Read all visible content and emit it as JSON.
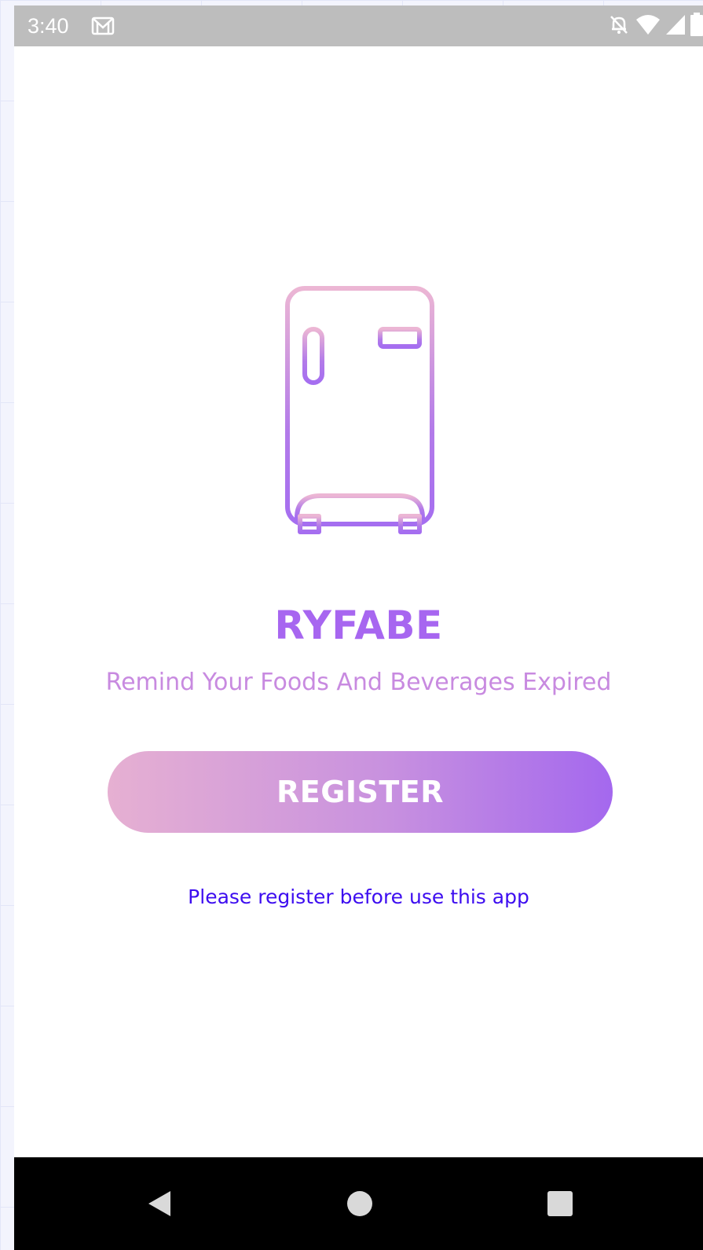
{
  "status_bar": {
    "time": "3:40",
    "icons": [
      "gmail-icon",
      "notifications-off-icon",
      "wifi-icon",
      "signal-icon",
      "battery-icon"
    ]
  },
  "app": {
    "logo_icon": "fridge-icon",
    "title": "RYFABE",
    "tagline": "Remind Your Foods And Beverages Expired"
  },
  "register": {
    "button_label": "REGISTER",
    "hint": "Please register before use this app"
  },
  "nav_bar": {
    "buttons": [
      "back",
      "home",
      "recents"
    ]
  },
  "colors": {
    "title": "#a766f0",
    "tagline": "#c88ae0",
    "hint": "#3d0df0",
    "gradient_start": "#e6b0d2",
    "gradient_end": "#a468ee",
    "status_bar": "#bdbdbd",
    "nav_bar": "#000000"
  }
}
